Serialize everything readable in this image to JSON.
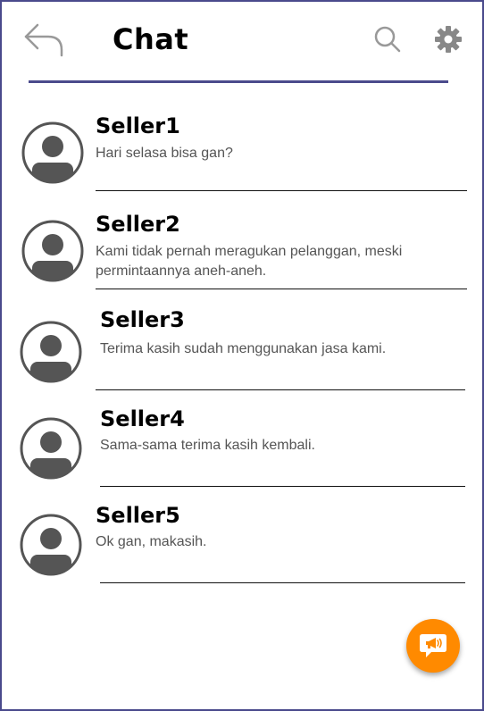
{
  "header": {
    "title": "Chat",
    "icons": {
      "back": "back-arrow-icon",
      "search": "search-icon",
      "settings": "gear-icon"
    }
  },
  "chats": [
    {
      "name": "Seller1",
      "message": "Hari selasa bisa gan?"
    },
    {
      "name": "Seller2",
      "message": "Kami tidak pernah meragukan pelanggan, meski permintaannya aneh-aneh."
    },
    {
      "name": "Seller3",
      "message": "Terima kasih sudah menggunakan jasa kami."
    },
    {
      "name": "Seller4",
      "message": "Sama-sama terima kasih kembali."
    },
    {
      "name": "Seller5",
      "message": "Ok gan, makasih."
    }
  ],
  "fab": {
    "icon": "new-chat-megaphone-icon"
  },
  "colors": {
    "accent": "#4a4a8c",
    "fab": "#ff8a00",
    "avatar": "#555555"
  }
}
